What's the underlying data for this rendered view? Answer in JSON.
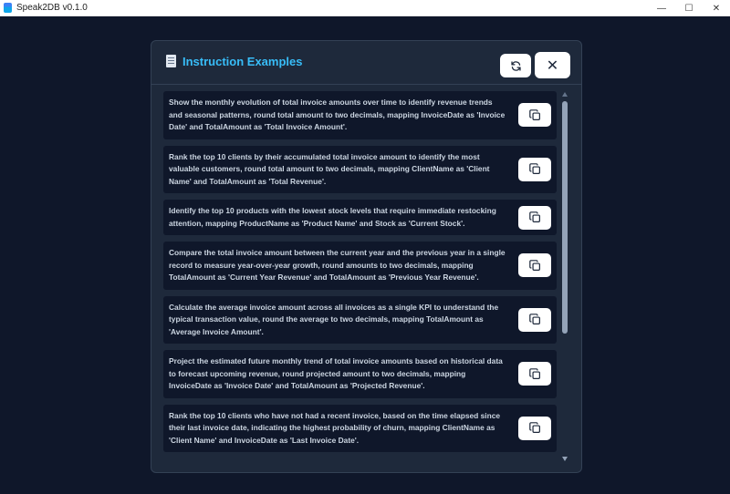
{
  "window": {
    "title": "Speak2DB v0.1.0",
    "controls": [
      "—",
      "☐",
      "✕"
    ]
  },
  "modal": {
    "title": "Instruction Examples",
    "icon": "document-icon",
    "refresh_icon": "refresh-icon",
    "close_icon": "close-icon",
    "close_glyph": "✕"
  },
  "examples": [
    {
      "text": "Show the monthly evolution of total invoice amounts over time to identify revenue trends and seasonal patterns, round total amount to two decimals, mapping InvoiceDate as 'Invoice Date' and TotalAmount as 'Total Invoice Amount'."
    },
    {
      "text": "Rank the top 10 clients by their accumulated total invoice amount to identify the most valuable customers, round total amount to two decimals, mapping ClientName as 'Client Name' and TotalAmount as 'Total Revenue'."
    },
    {
      "text": "Identify the top 10 products with the lowest stock levels that require immediate restocking attention, mapping ProductName as 'Product Name' and Stock as 'Current Stock'."
    },
    {
      "text": "Compare the total invoice amount between the current year and the previous year in a single record to measure year-over-year growth, round amounts to two decimals, mapping TotalAmount as 'Current Year Revenue' and TotalAmount as 'Previous Year Revenue'."
    },
    {
      "text": "Calculate the average invoice amount across all invoices as a single KPI to understand the typical transaction value, round the average to two decimals, mapping TotalAmount as 'Average Invoice Amount'."
    },
    {
      "text": "Project the estimated future monthly trend of total invoice amounts based on historical data to forecast upcoming revenue, round projected amount to two decimals, mapping InvoiceDate as 'Invoice Date' and TotalAmount as 'Projected Revenue'."
    },
    {
      "text": "Rank the top 10 clients who have not had a recent invoice, based on the time elapsed since their last invoice date, indicating the highest probability of churn, mapping ClientName as 'Client Name' and InvoiceDate as 'Last Invoice Date'."
    }
  ],
  "copy_icon": "copy-icon"
}
